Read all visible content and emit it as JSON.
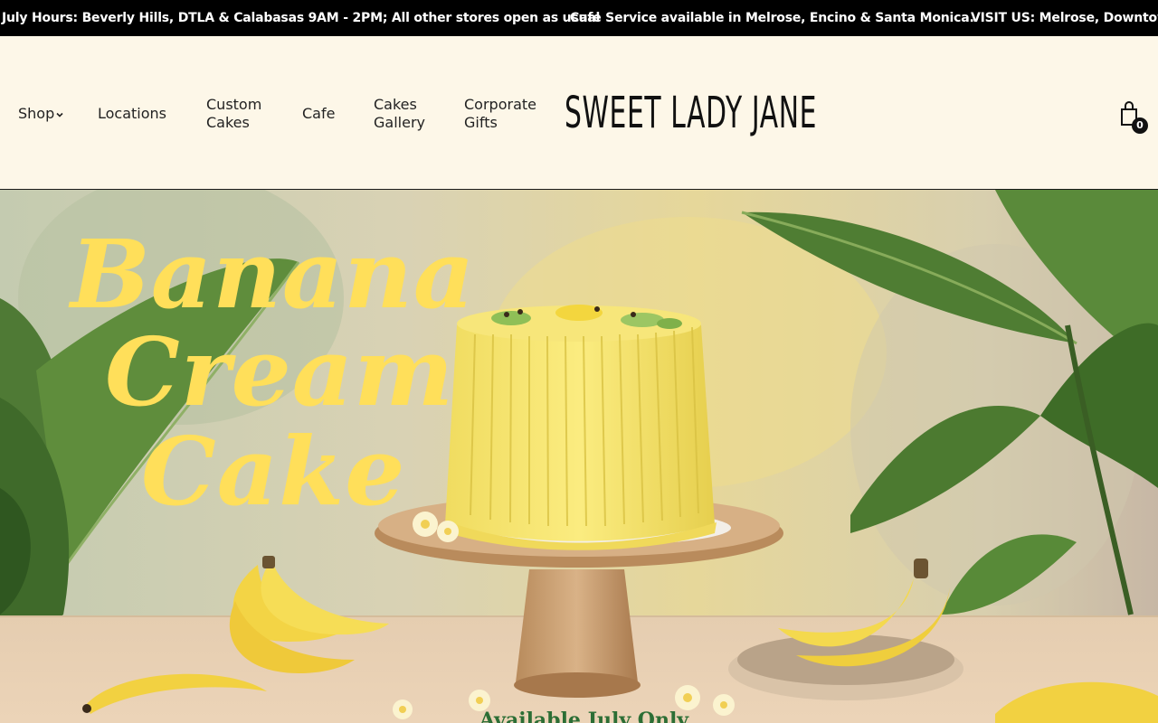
{
  "announcement": {
    "messages": [
      "July Hours: Beverly Hills, DTLA & Calabasas 9AM - 2PM; All other stores open as usual",
      "Cafe Service available in Melrose, Encino & Santa Monica.",
      "VISIT US: Melrose, Downtown LA"
    ]
  },
  "nav": {
    "shop": "Shop",
    "locations": "Locations",
    "custom_cakes": [
      "Custom",
      "Cakes"
    ],
    "cafe": "Cafe",
    "cakes_gallery": [
      "Cakes",
      "Gallery"
    ],
    "corporate_gifts": [
      "Corporate",
      "Gifts"
    ]
  },
  "logo": "SWEET LADY JANE",
  "cart": {
    "count": "0",
    "icon": "shopping-bag-icon"
  },
  "hero": {
    "title_lines": [
      "Banana",
      "Cream",
      "Cake"
    ],
    "subtitle": "Available July Only",
    "title_color": "#ffdf5a",
    "subtitle_color": "#2c6e35"
  },
  "colors": {
    "background": "#fdf7e8",
    "announcement_bg": "#000000"
  }
}
